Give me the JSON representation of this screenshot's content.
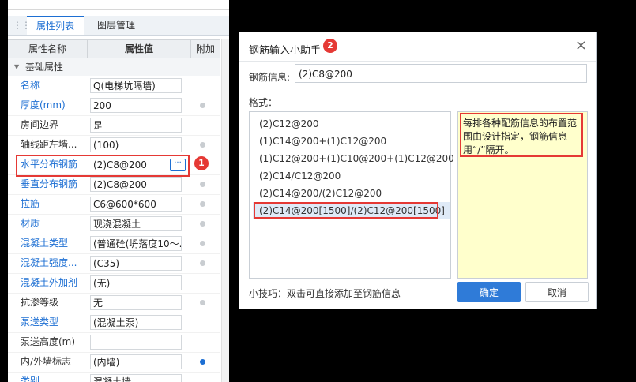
{
  "tabs": [
    {
      "label": "属性列表"
    },
    {
      "label": "图层管理"
    }
  ],
  "table": {
    "col_name": "属性名称",
    "col_value": "属性值",
    "col_extra": "附加"
  },
  "group": {
    "label": "基础属性"
  },
  "properties": [
    {
      "name": "名称",
      "value": "Q(电梯坑隔墙)",
      "blue": true,
      "dot": "none"
    },
    {
      "name": "厚度(mm)",
      "value": "200",
      "blue": true,
      "dot": "off"
    },
    {
      "name": "房间边界",
      "value": "是",
      "blue": false,
      "dot": "none"
    },
    {
      "name": "轴线距左墙...",
      "value": "(100)",
      "blue": false,
      "dot": "off"
    },
    {
      "name": "水平分布钢筋",
      "value": "(2)C8@200",
      "blue": true,
      "dot": "none"
    },
    {
      "name": "垂直分布钢筋",
      "value": "(2)C8@200",
      "blue": true,
      "dot": "off"
    },
    {
      "name": "拉筋",
      "value": "C6@600*600",
      "blue": true,
      "dot": "off"
    },
    {
      "name": "材质",
      "value": "现浇混凝土",
      "blue": true,
      "dot": "off"
    },
    {
      "name": "混凝土类型",
      "value": "(普通砼(坍落度10～...",
      "blue": true,
      "dot": "off"
    },
    {
      "name": "混凝土强度...",
      "value": "(C35)",
      "blue": true,
      "dot": "off"
    },
    {
      "name": "混凝土外加剂",
      "value": "(无)",
      "blue": true,
      "dot": "none"
    },
    {
      "name": "抗渗等级",
      "value": "无",
      "blue": false,
      "dot": "off"
    },
    {
      "name": "泵送类型",
      "value": "(混凝土泵)",
      "blue": true,
      "dot": "none"
    },
    {
      "name": "泵送高度(m)",
      "value": "",
      "blue": false,
      "dot": "none"
    },
    {
      "name": "内/外墙标志",
      "value": "(内墙)",
      "blue": false,
      "dot": "on"
    },
    {
      "name": "类别",
      "value": "混凝土墙",
      "blue": true,
      "dot": "none"
    }
  ],
  "badges": {
    "one": "1",
    "two": "2"
  },
  "ellipsis": "···",
  "dialog": {
    "title": "钢筋输入小助手",
    "close": "×",
    "info_label": "钢筋信息:",
    "info_value": "(2)C8@200",
    "format_label": "格式：",
    "formats": [
      "(2)C12@200",
      "(1)C14@200+(1)C12@200",
      "(1)C12@200+(1)C10@200+(1)C12@200",
      "(2)C14/C12@200",
      "(2)C14@200/(2)C12@200",
      "(2)C14@200[1500]/(2)C12@200[1500]"
    ],
    "description": "每排各种配筋信息的布置范围由设计指定，钢筋信息用“/”隔开。",
    "tip": "小技巧：双击可直接添加至钢筋信息",
    "ok": "确定",
    "cancel": "取消"
  },
  "colors": {
    "accent": "#1d6fd3",
    "highlight": "#e53935",
    "desc_bg": "#ffffcc",
    "ok_bg": "#2f7bd8"
  }
}
